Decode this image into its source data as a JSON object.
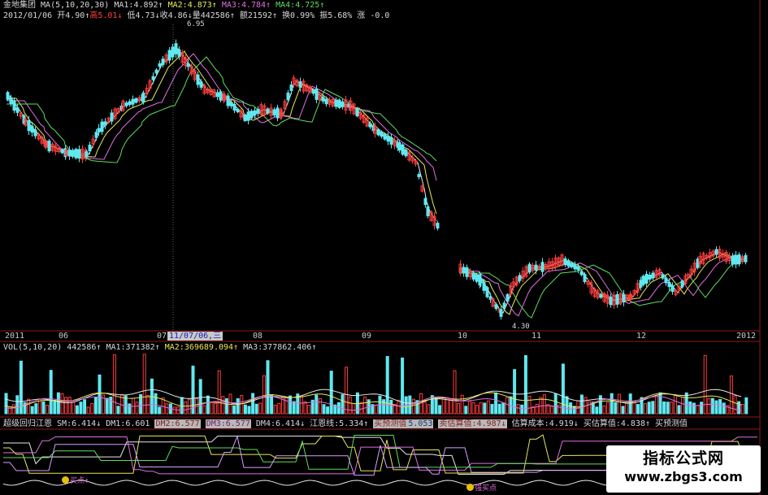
{
  "header": {
    "stock_name": "金地集团",
    "ma_label": "MA(5,10,20,30)",
    "ma1": "MA1:4.892↑",
    "ma2": "MA2:4.873↑",
    "ma3": "MA3:4.784↑",
    "ma4": "MA4:4.725↑",
    "date": "2012/01/06",
    "open": "开4.90↑",
    "high": "高5.01↓",
    "low": "低4.73↓",
    "close": "收4.86↓",
    "volume": "量442586↑",
    "amount": "额21592↑",
    "turnover": "换0.99%",
    "amplitude": "振5.68%",
    "change": "涨 -0.0"
  },
  "price_annotations": {
    "max": "6.95",
    "min": "4.30"
  },
  "xaxis": {
    "labels": [
      "2011",
      "06",
      "07",
      "08",
      "09",
      "10",
      "11",
      "12",
      "2012"
    ],
    "cursor_date": "11/07/06,三"
  },
  "volume_header": {
    "label": "VOL(5,10,20)",
    "value": "442586↑",
    "ma1": "MA1:371382↑",
    "ma2": "MA2:369689.094↑",
    "ma3": "MA3:377862.406↑"
  },
  "indicator_header": {
    "name": "超级回归江恩",
    "sm": "SM:6.414↓",
    "dm1": "DM1:6.601",
    "dm2": "DM2:6.577",
    "dm3": "DM3:6.577",
    "dm4": "DM4:6.414↓",
    "jiang_en": "江恩线:5.334↑",
    "estimate_buy": "买预测值",
    "est_buy_val": "5.053",
    "estimate_sell": "卖估算值:4.987↓",
    "est_cost": "估算成本:4.919↓",
    "buy_est": "买估算值:4.838↑",
    "buy_forecast": "买预测值"
  },
  "signals": {
    "buy_point": "买点↑",
    "strong_buy": "强买点"
  },
  "watermark": {
    "title": "指标公式网",
    "url": "www.zbgs3.com"
  },
  "colors": {
    "up": "#ff3c3c",
    "down": "#5fe8f0",
    "ma1": "#e8e8e8",
    "ma2": "#e8e85a",
    "ma3": "#e070e0",
    "ma4": "#5fdc5f",
    "grid": "#8b1a1a",
    "bg": "#000000"
  }
}
